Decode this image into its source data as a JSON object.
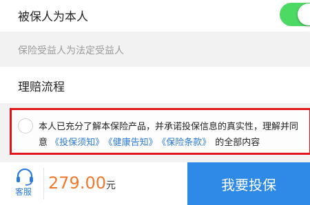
{
  "insured_self": {
    "label": "被保人为本人",
    "toggle_on": true
  },
  "beneficiary_note": "保险受益人为法定受益人",
  "claims_process": {
    "label": "理赔流程"
  },
  "agreement": {
    "line1": "本人已充分了解本保险产品，并承诺投保信息的真实性，理解并同",
    "line2_prefix": "意",
    "links": [
      "《投保须知》",
      "《健康告知》",
      "《保险条款》"
    ],
    "line2_suffix": "的全部内容"
  },
  "bottom_bar": {
    "service_label": "客服",
    "price_value": "279.00",
    "price_unit": "元",
    "buy_label": "我要投保"
  },
  "colors": {
    "toggle": "#4cd964",
    "link": "#2a7ad9",
    "highlight_border": "#e1141c",
    "price": "#f0782c",
    "button": "#2e8ae6"
  }
}
